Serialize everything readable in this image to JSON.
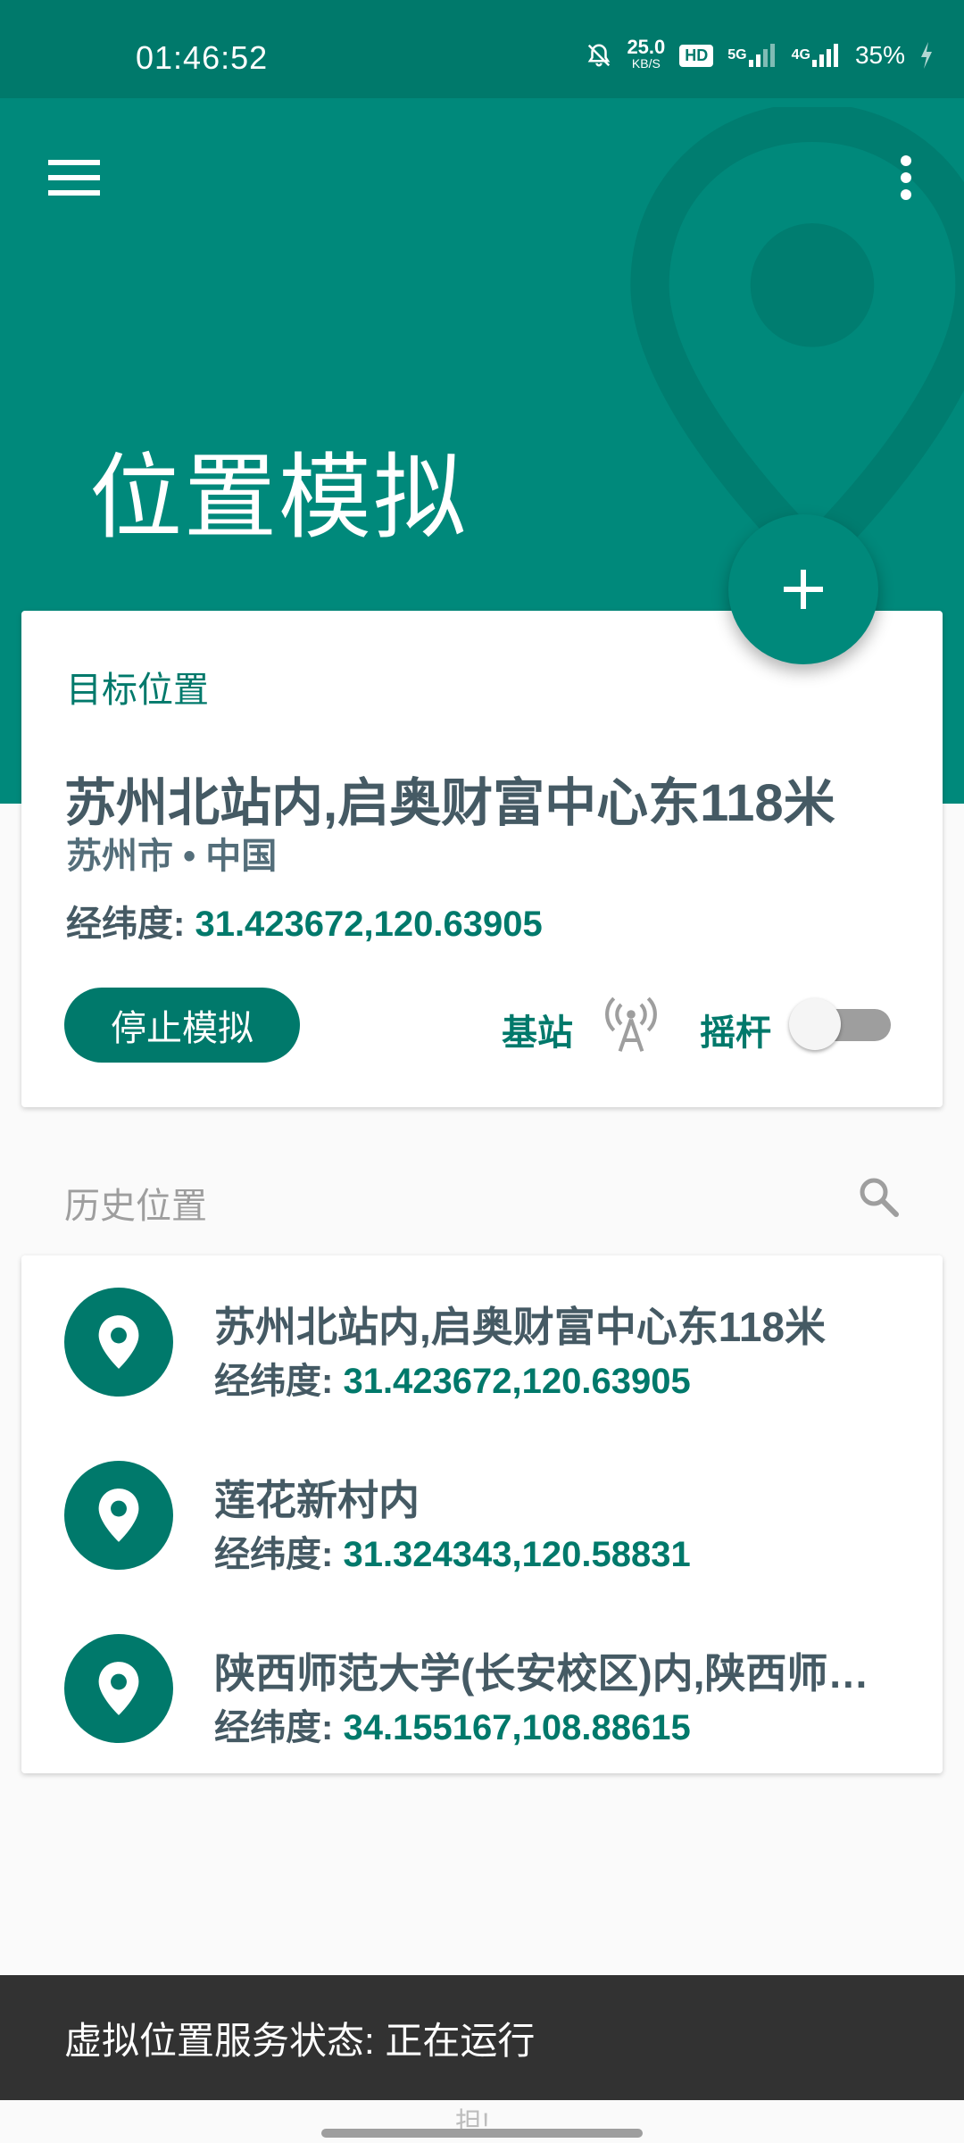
{
  "status_bar": {
    "time": "01:46:52",
    "net_speed_value": "25.0",
    "net_speed_unit": "KB/S",
    "hd_badge": "HD",
    "sim1_label": "5G",
    "sim2_label": "4G",
    "battery": "35%"
  },
  "header": {
    "title": "位置模拟"
  },
  "target_card": {
    "label": "目标位置",
    "place_name": "苏州北站内,启奥财富中心东118米",
    "place_sub": "苏州市 • 中国",
    "coord_key": "经纬度:",
    "coord_value": "31.423672,120.63905",
    "stop_button": "停止模拟",
    "station_label": "基站",
    "joystick_label": "摇杆",
    "joystick_on": false
  },
  "history": {
    "title": "历史位置",
    "items": [
      {
        "name": "苏州北站内,启奥财富中心东118米",
        "coord_key": "经纬度:",
        "coord_value": "31.423672,120.63905"
      },
      {
        "name": "莲花新村内",
        "coord_key": "经纬度:",
        "coord_value": "31.324343,120.58831"
      },
      {
        "name": "陕西师范大学(长安校区)内,陕西师…",
        "coord_key": "经纬度:",
        "coord_value": "34.155167,108.88615"
      }
    ]
  },
  "snackbar": {
    "text": "虚拟位置服务状态: 正在运行"
  },
  "bottom_peek": "担!",
  "colors": {
    "status_bar": "#00796b",
    "header": "#00897b",
    "accent": "#00796b",
    "text_dark": "#455a64",
    "snackbar": "#323232"
  },
  "icons": {
    "menu": "menu-icon",
    "more": "more-vert-icon",
    "fab": "plus-icon",
    "station": "cell-tower-icon",
    "search": "search-icon",
    "pin": "location-pin-icon"
  }
}
